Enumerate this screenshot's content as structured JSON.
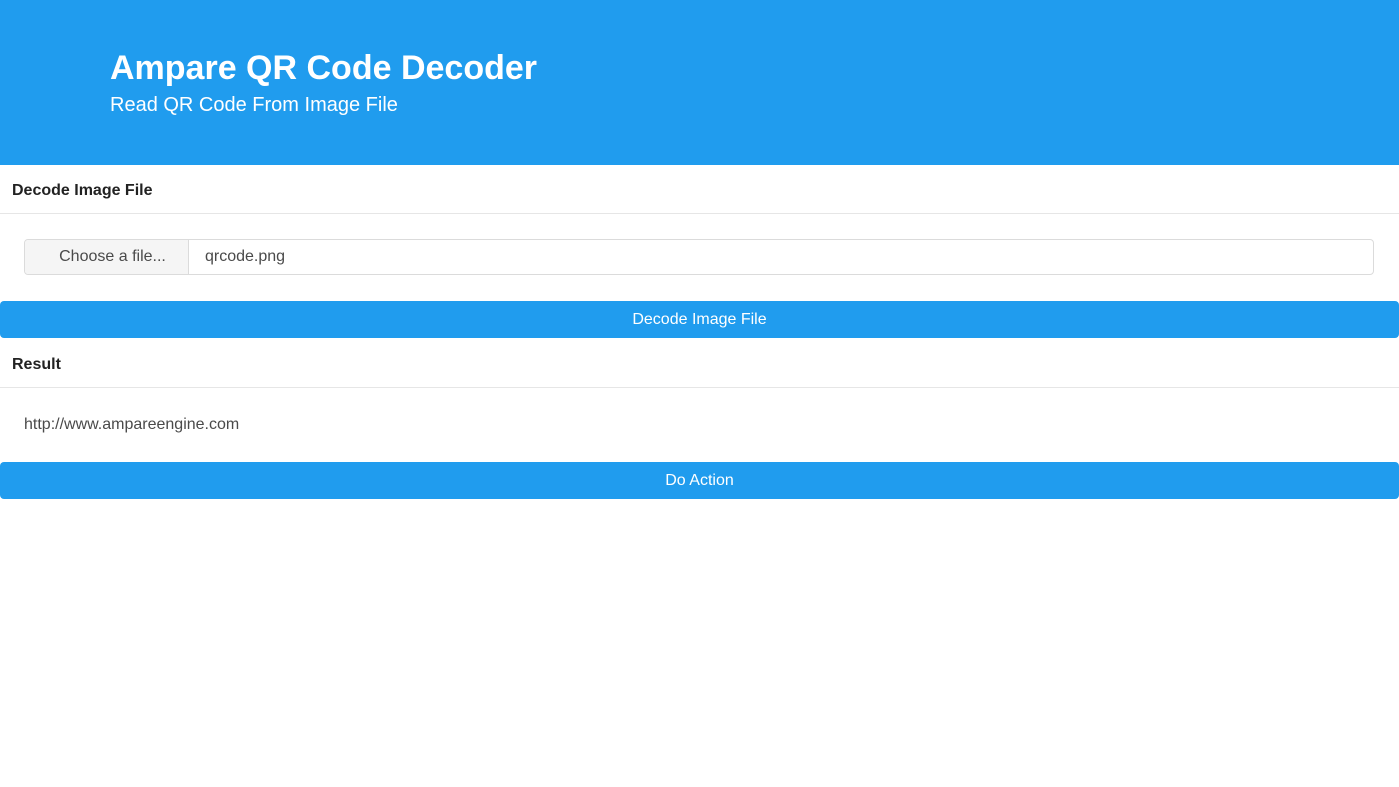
{
  "header": {
    "title": "Ampare QR Code Decoder",
    "subtitle": "Read QR Code From Image File"
  },
  "decode_section": {
    "heading": "Decode Image File",
    "file_button_label": "Choose a file...",
    "file_name": "qrcode.png",
    "decode_button_label": "Decode Image File"
  },
  "result_section": {
    "heading": "Result",
    "result_value": "http://www.ampareengine.com",
    "action_button_label": "Do Action"
  },
  "colors": {
    "accent": "#209cee",
    "text": "#333333"
  }
}
